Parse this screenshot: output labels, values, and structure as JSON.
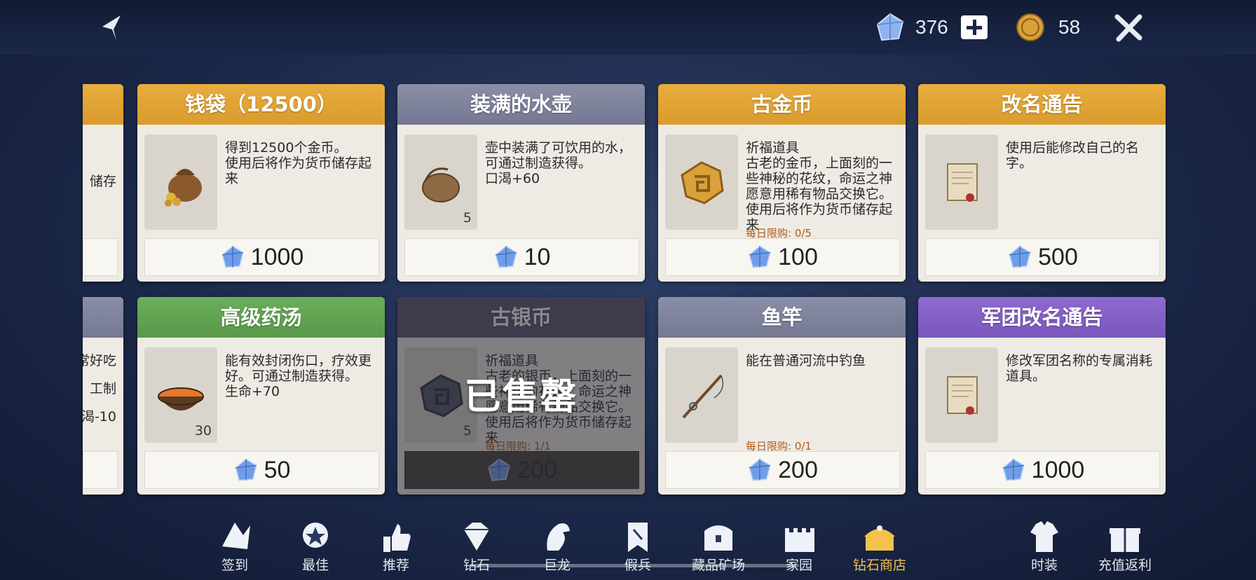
{
  "topbar": {
    "diamond_amount": "376",
    "gold_amount": "58",
    "icons": [
      "back-icon",
      "diamond-icon",
      "plus-icon",
      "gold-coin-icon",
      "close-icon"
    ]
  },
  "partial_cards": [
    {
      "text_lines": [
        "储存"
      ]
    },
    {
      "text_lines": [
        "常好吃",
        "工制",
        "渴-10"
      ]
    }
  ],
  "items": [
    {
      "title": "钱袋（12500）",
      "color": "#e0a437",
      "desc": "得到12500个金币。\n使用后将作为货币储存起来",
      "qty": "",
      "limit": "",
      "price": "1000",
      "sold_out": false,
      "icon": "money-bag-icon"
    },
    {
      "title": "装满的水壶",
      "color": "#7e829c",
      "desc": "壶中装满了可饮用的水，可通过制造获得。\n口渴+60",
      "qty": "5",
      "limit": "",
      "price": "10",
      "sold_out": false,
      "icon": "water-flask-icon"
    },
    {
      "title": "古金币",
      "color": "#e0a437",
      "desc": "祈福道具\n古老的金币，上面刻的一些神秘的花纹，命运之神愿意用稀有物品交换它。\n使用后将作为货币储存起来",
      "qty": "",
      "limit": "每日限购: 0/5",
      "price": "100",
      "sold_out": false,
      "icon": "ancient-gold-coin-icon"
    },
    {
      "title": "改名通告",
      "color": "#e0a437",
      "desc": "使用后能修改自己的名字。",
      "qty": "",
      "limit": "",
      "price": "500",
      "sold_out": false,
      "icon": "scroll-icon"
    },
    {
      "title": "高级药汤",
      "color": "#62a552",
      "desc": "能有效封闭伤口，疗效更好。可通过制造获得。\n生命+70",
      "qty": "30",
      "limit": "",
      "price": "50",
      "sold_out": false,
      "icon": "potion-bowl-icon"
    },
    {
      "title": "古银币",
      "color": "#5a5470",
      "desc": "祈福道具\n古老的银币，上面刻的一些神秘的花纹，命运之神愿意用稀有物品交换它。\n使用后将作为货币储存起来",
      "qty": "5",
      "limit": "每日限购: 1/1",
      "price": "200",
      "sold_out": true,
      "sold_out_label": "已售罄",
      "icon": "ancient-silver-coin-icon"
    },
    {
      "title": "鱼竿",
      "color": "#7e829c",
      "desc": "能在普通河流中钓鱼",
      "qty": "",
      "limit": "每日限购: 0/1",
      "price": "200",
      "sold_out": false,
      "icon": "fishing-rod-icon"
    },
    {
      "title": "军团改名通告",
      "color": "#8a64cb",
      "desc": "修改军团名称的专属消耗道具。",
      "qty": "",
      "limit": "",
      "price": "1000",
      "sold_out": false,
      "icon": "scroll-icon"
    }
  ],
  "nav": [
    {
      "label": "签到",
      "icon": "check-in-icon",
      "active": false
    },
    {
      "label": "最佳",
      "icon": "best-badge-icon",
      "active": false
    },
    {
      "label": "推荐",
      "icon": "thumbs-up-icon",
      "active": false
    },
    {
      "label": "钻石",
      "icon": "diamond-icon",
      "active": false
    },
    {
      "label": "巨龙",
      "icon": "dragon-icon",
      "active": false
    },
    {
      "label": "假兵",
      "icon": "banner-icon",
      "active": false
    },
    {
      "label": "藏品矿场",
      "icon": "treasure-chest-icon",
      "active": false
    },
    {
      "label": "家园",
      "icon": "castle-icon",
      "active": false
    },
    {
      "label": "钻石商店",
      "icon": "diamond-shop-icon",
      "active": true
    },
    {
      "label": "时装",
      "icon": "fashion-icon",
      "active": false
    },
    {
      "label": "充值返利",
      "icon": "gift-icon",
      "active": false
    }
  ]
}
